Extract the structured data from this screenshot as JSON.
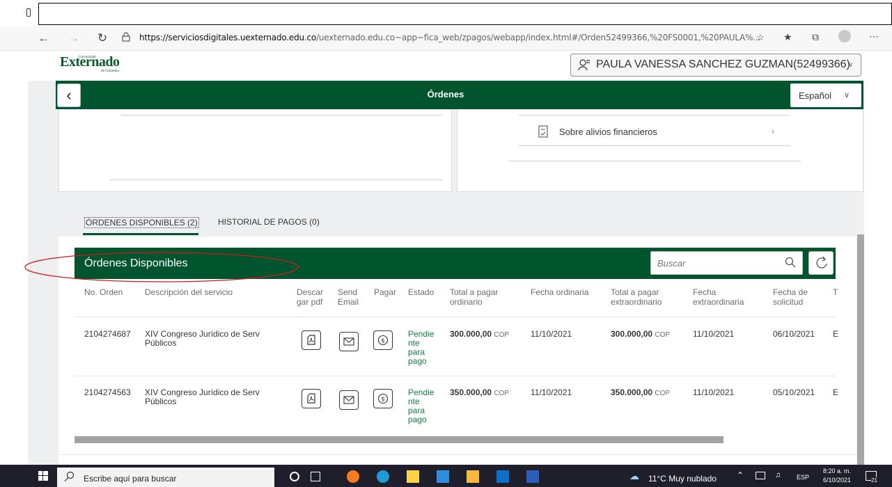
{
  "browser": {
    "url_host": "https://serviciosdigitales.uexternado.edu.co",
    "url_path": "/uexternado.edu.co~app~fica_web/zpagos/webapp/index.html#/Orden52499366,%20FS0001,%20PAULA%..."
  },
  "header": {
    "logo_main": "Externado",
    "logo_top": "Universidad",
    "logo_bottom": "de Colombia",
    "user_name": "PAULA VANESSA SANCHEZ GUZMAN(52499366)"
  },
  "app_bar": {
    "title": "Órdenes",
    "language": "Español"
  },
  "panels": {
    "alivios_label": "Sobre alivios financieros"
  },
  "tabs": [
    {
      "label": "ÓRDENES DISPONIBLES (2)",
      "selected": true
    },
    {
      "label": "HISTORIAL DE PAGOS (0)",
      "selected": false
    }
  ],
  "table": {
    "title": "Órdenes Disponibles",
    "search_placeholder": "Buscar",
    "columns": [
      {
        "l1": "No. Orden",
        "l2": ""
      },
      {
        "l1": "Descripción del servicio",
        "l2": ""
      },
      {
        "l1": "Descar",
        "l2": "gar pdf"
      },
      {
        "l1": "Send",
        "l2": "Email"
      },
      {
        "l1": "Pagar",
        "l2": ""
      },
      {
        "l1": "Estado",
        "l2": ""
      },
      {
        "l1": "Total a pagar",
        "l2": "ordinario"
      },
      {
        "l1": "Fecha ordinaria",
        "l2": ""
      },
      {
        "l1": "Total a pagar",
        "l2": "extraordinario"
      },
      {
        "l1": "Fecha",
        "l2": "extraordinaria"
      },
      {
        "l1": "Fecha de",
        "l2": "solicitud"
      },
      {
        "l1": "T",
        "l2": ""
      }
    ],
    "rows": [
      {
        "orden": "2104274687",
        "desc_l1": "XIV Congreso Jurídico de Serv",
        "desc_l2": "Públicos",
        "estado": [
          "Pendie",
          "nte",
          "para",
          "pago"
        ],
        "total_ord": "300.000,00",
        "cur_ord": "COP",
        "fecha_ord": "11/10/2021",
        "total_ext": "300.000,00",
        "cur_ext": "COP",
        "fecha_ext": "11/10/2021",
        "fecha_sol": "06/10/2021",
        "trunc": "E"
      },
      {
        "orden": "2104274563",
        "desc_l1": "XIV Congreso Jurídico de Serv",
        "desc_l2": "Públicos",
        "estado": [
          "Pendie",
          "nte",
          "para",
          "pago"
        ],
        "total_ord": "350.000,00",
        "cur_ord": "COP",
        "fecha_ord": "11/10/2021",
        "total_ext": "350.000,00",
        "cur_ext": "COP",
        "fecha_ext": "11/10/2021",
        "fecha_sol": "05/10/2021",
        "trunc": "E"
      }
    ]
  },
  "taskbar": {
    "search_text": "Escribe aquí para buscar",
    "weather": "11°C  Muy nublado",
    "lang": "ESP",
    "time": "8:20 a. m.",
    "date": "6/10/2021",
    "notif_count": "21"
  },
  "colors": {
    "brand_green": "#00552f",
    "status_green": "#107e3e",
    "annotation_red": "#d11a1a"
  }
}
